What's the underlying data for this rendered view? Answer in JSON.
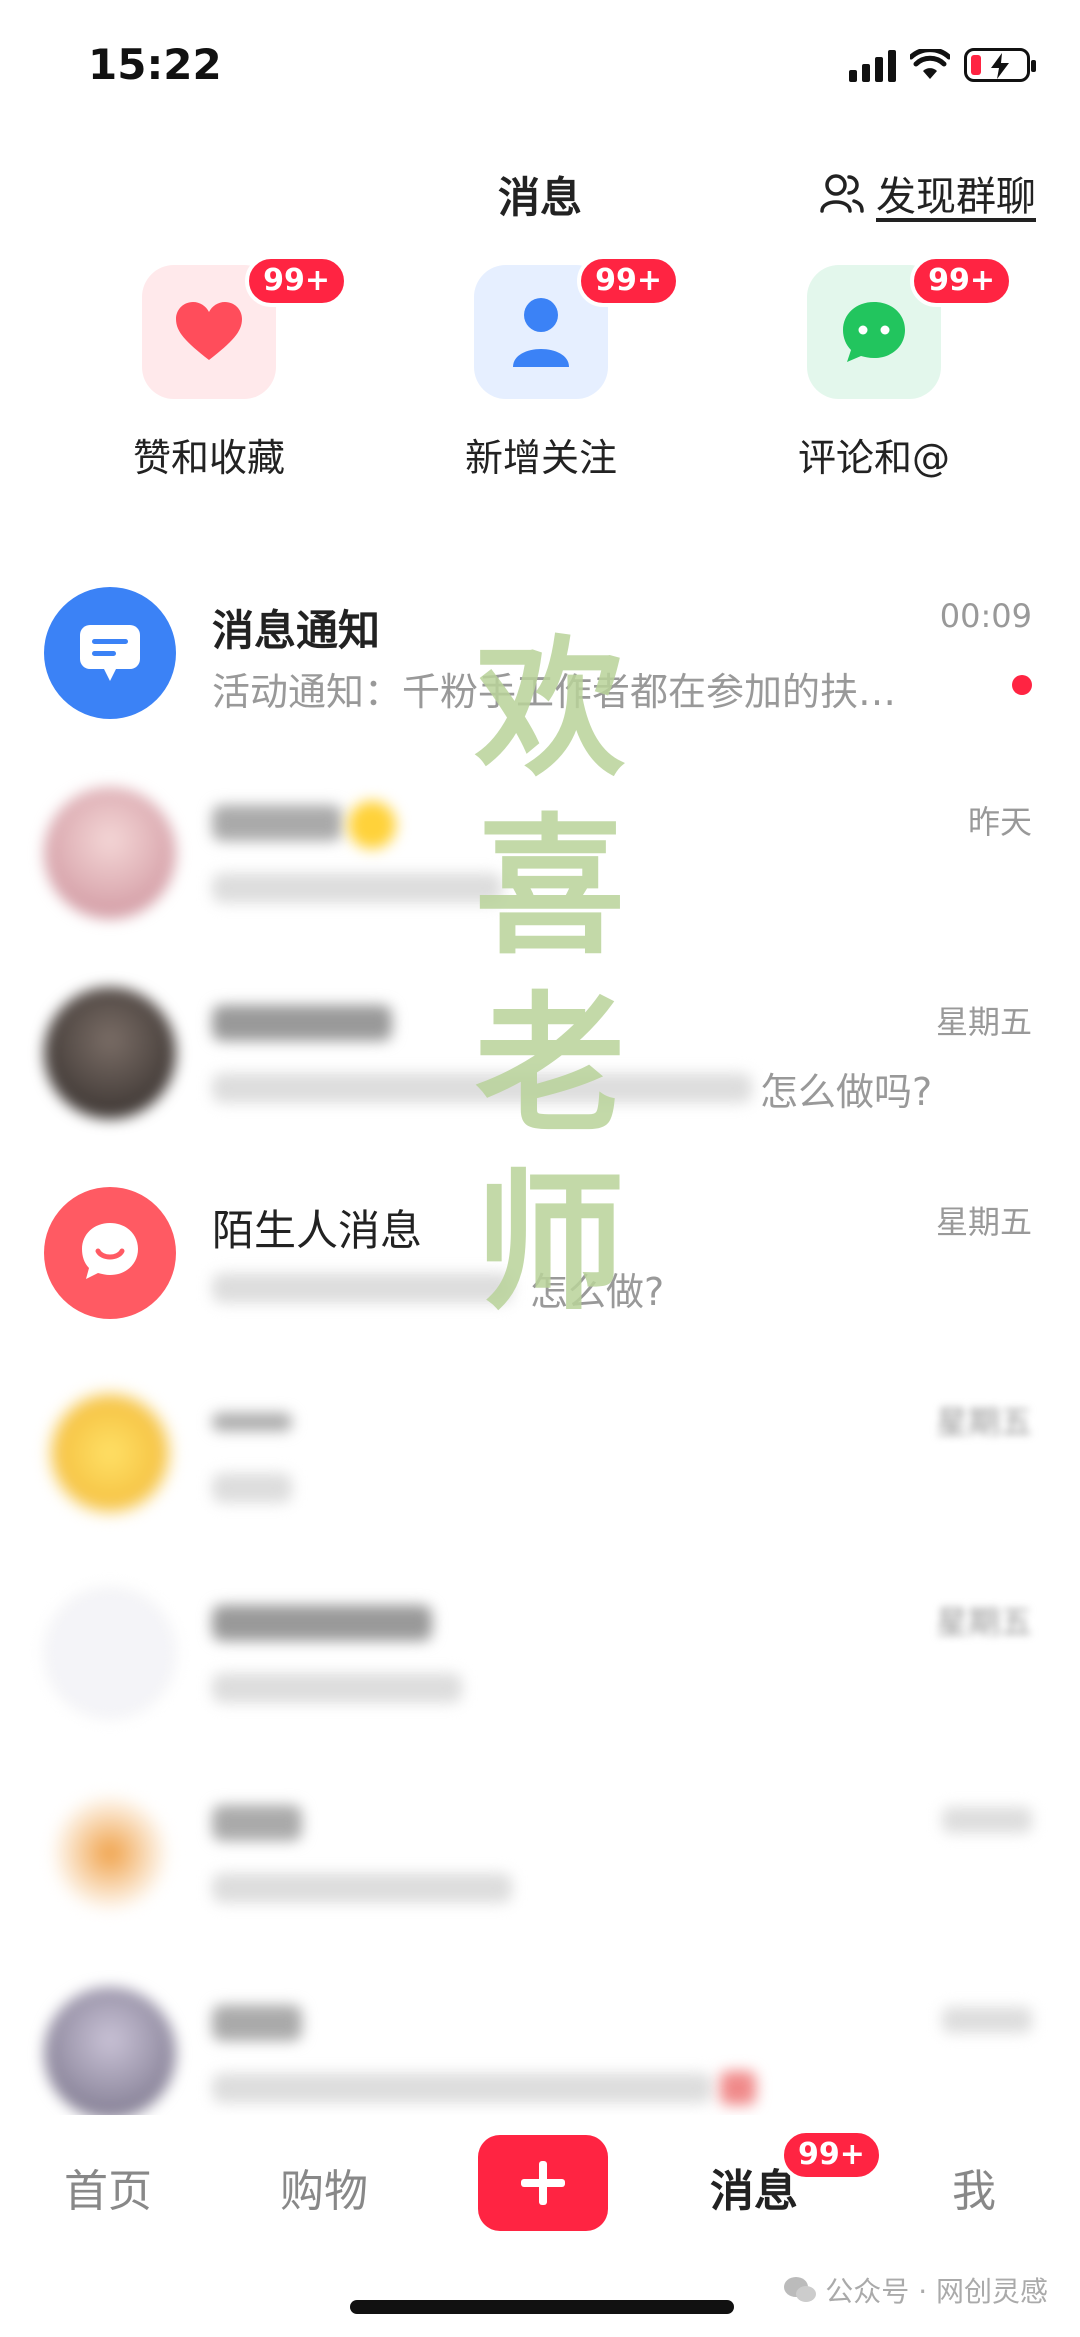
{
  "status_bar": {
    "time": "15:22"
  },
  "header": {
    "title": "消息",
    "discover_label": "发现群聊"
  },
  "quick_entries": [
    {
      "label": "赞和收藏",
      "badge": "99+",
      "icon": "heart-icon",
      "bg": "#ffe8ea",
      "color": "#ff4d5b"
    },
    {
      "label": "新增关注",
      "badge": "99+",
      "icon": "person-icon",
      "bg": "#e6efff",
      "color": "#3b82f6"
    },
    {
      "label": "评论和@",
      "badge": "99+",
      "icon": "chat-bubble-icon",
      "bg": "#e3f7ec",
      "color": "#22c55e"
    }
  ],
  "messages": [
    {
      "title": "消息通知",
      "subtitle": "活动通知：千粉手工作者都在参加的扶…",
      "time": "00:09",
      "unread": true
    },
    {
      "title": "陌生人消息",
      "subtitle_tail": "怎么做?",
      "time": "星期五"
    }
  ],
  "blurred_rows": [
    {
      "time": "昨天"
    },
    {
      "time": "星期五",
      "subtitle_tail": "怎么做吗?"
    },
    {
      "time": "星期五"
    },
    {
      "time": "星期五"
    }
  ],
  "watermark": [
    "欢",
    "喜",
    "老",
    "师"
  ],
  "tabbar": {
    "home": "首页",
    "shop": "购物",
    "messages": "消息",
    "messages_badge": "99+",
    "me": "我"
  },
  "source_mark": "公众号 · 网创灵感",
  "colors": {
    "accent": "#ff2442"
  }
}
